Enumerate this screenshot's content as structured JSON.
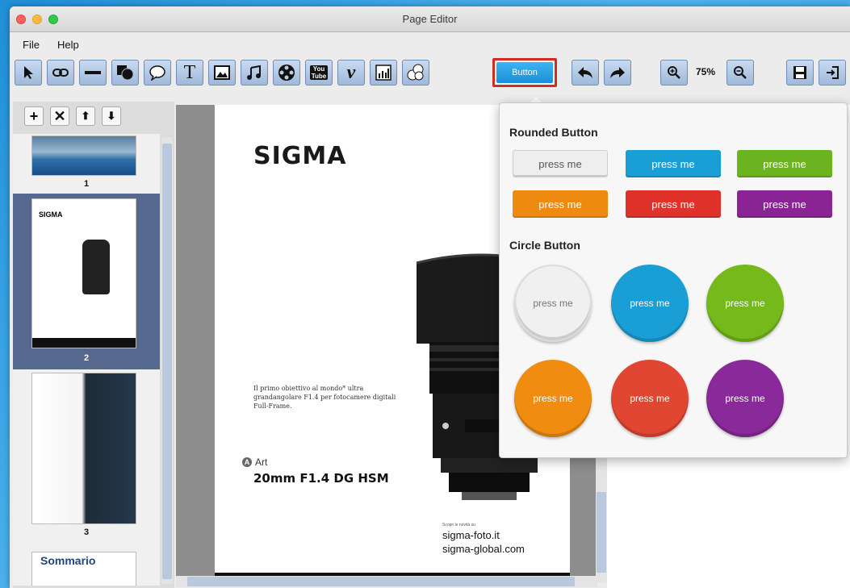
{
  "window": {
    "title": "Page Editor"
  },
  "menu": {
    "file": "File",
    "help": "Help"
  },
  "toolbar": {
    "button_tool_label": "Button",
    "zoom_level": "75%",
    "text_tool": "T",
    "youtube_top": "You",
    "youtube_bottom": "Tube",
    "vimeo": "v"
  },
  "sidebar": {
    "tools": {
      "add": "+",
      "remove": "✕",
      "up": "⬆",
      "down": "⬇"
    },
    "thumbnails": [
      {
        "number": "1"
      },
      {
        "number": "2",
        "selected": true,
        "header": "SIGMA"
      },
      {
        "number": "3"
      },
      {
        "number": "",
        "header": "Sommario"
      }
    ]
  },
  "document": {
    "logo": "SIGMA",
    "body_text": "Il primo obiettivo al mondo* ultra grandangolare F1.4 per fotocamere digitali Full-Frame.",
    "series": "Art",
    "series_badge": "A",
    "model": "20mm F1.4 DG HSM",
    "web_label": "Scopri le novità su",
    "web1": "sigma-foto.it",
    "web2": "sigma-global.com"
  },
  "popup": {
    "rounded_title": "Rounded Button",
    "circle_title": "Circle Button",
    "rounded_buttons": [
      {
        "label": "press me",
        "color": "#eeeeee",
        "text_color": "#555555"
      },
      {
        "label": "press me",
        "color": "#1a9ed6",
        "text_color": "#ffffff"
      },
      {
        "label": "press me",
        "color": "#6cb41f",
        "text_color": "#ffffff"
      },
      {
        "label": "press me",
        "color": "#ef8a10",
        "text_color": "#ffffff"
      },
      {
        "label": "press me",
        "color": "#e0322a",
        "text_color": "#ffffff"
      },
      {
        "label": "press me",
        "color": "#8a2495",
        "text_color": "#ffffff"
      }
    ],
    "circle_buttons": [
      {
        "label": "press me",
        "color": "#f0f0f0",
        "text_color": "#777777"
      },
      {
        "label": "press me",
        "color": "#1a9ed6",
        "text_color": "#ffffff"
      },
      {
        "label": "press me",
        "color": "#75b91b",
        "text_color": "#ffffff"
      },
      {
        "label": "press me",
        "color": "#f08c10",
        "text_color": "#ffffff"
      },
      {
        "label": "press me",
        "color": "#e04632",
        "text_color": "#ffffff"
      },
      {
        "label": "press me",
        "color": "#8a2a9a",
        "text_color": "#ffffff"
      }
    ]
  },
  "colors": {
    "accent": "#1a8fd6",
    "highlight_border": "#d42a20",
    "selection": "#56688d"
  }
}
